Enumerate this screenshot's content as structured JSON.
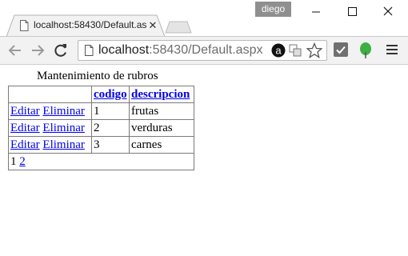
{
  "window": {
    "user": "diego",
    "controls": {
      "minimize": "minimize",
      "maximize": "maximize",
      "close": "close"
    }
  },
  "tab": {
    "title": "localhost:58430/Default.aspx",
    "close_glyph": "✕"
  },
  "toolbar": {
    "url_host": "localhost",
    "url_rest": ":58430/Default.aspx",
    "icons": [
      "back-arrow-icon",
      "forward-arrow-icon",
      "reload-icon",
      "page-icon",
      "extension-a-icon",
      "translate-icon",
      "star-icon",
      "checkmark-extension-icon",
      "leaf-extension-icon",
      "menu-icon"
    ]
  },
  "page": {
    "caption": "Mantenimiento de rubros",
    "columns": {
      "codigo": "codigo",
      "descripcion": "descripcion"
    },
    "actions": {
      "edit": "Editar",
      "delete": "Eliminar"
    },
    "rows": [
      {
        "codigo": "1",
        "descripcion": "frutas"
      },
      {
        "codigo": "2",
        "descripcion": "verduras"
      },
      {
        "codigo": "3",
        "descripcion": "carnes"
      }
    ],
    "pager": {
      "current": "1",
      "next": "2"
    }
  },
  "colors": {
    "link": "#0000ee",
    "toolbar": "#f2f2f2",
    "user_badge": "#8f8f8f"
  }
}
